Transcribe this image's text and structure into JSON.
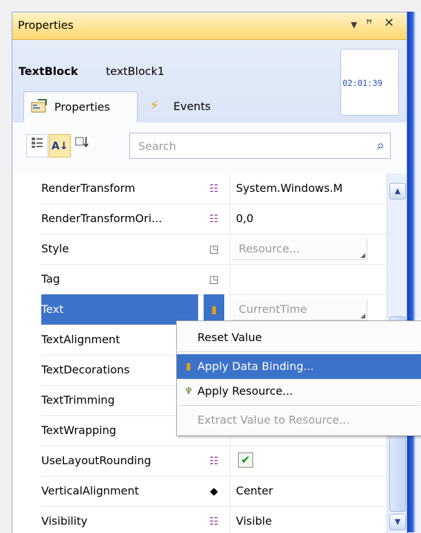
{
  "panel": {
    "title": "Properties",
    "title_icons": [
      "dropdown-arrow-icon",
      "pin-icon",
      "close-icon"
    ]
  },
  "header": {
    "type_name": "TextBlock",
    "instance_name": "textBlock1",
    "preview_text": "02:01:39"
  },
  "tabs": [
    {
      "label": "Properties",
      "icon": "properties-icon",
      "active": true
    },
    {
      "label": "Events",
      "icon": "lightning-icon",
      "active": false
    }
  ],
  "search": {
    "placeholder": "Search",
    "value": ""
  },
  "rows": [
    {
      "name": "RenderTransform",
      "marker": "advanced-properties-icon",
      "value": "System.Windows.M"
    },
    {
      "name": "RenderTransformOri...",
      "marker": "advanced-properties-icon",
      "value": "0,0"
    },
    {
      "name": "Style",
      "marker": "resource-square-icon",
      "value": "Resource..."
    },
    {
      "name": "Tag",
      "marker": "resource-square-icon",
      "value": ""
    },
    {
      "name": "Text",
      "marker": "data-binding-icon",
      "value": "CurrentTime",
      "selected": true
    },
    {
      "name": "TextAlignment",
      "marker": "",
      "value": ""
    },
    {
      "name": "TextDecorations",
      "marker": "",
      "value": ""
    },
    {
      "name": "TextTrimming",
      "marker": "",
      "value": ""
    },
    {
      "name": "TextWrapping",
      "marker": "",
      "value": ""
    },
    {
      "name": "UseLayoutRounding",
      "marker": "advanced-properties-icon",
      "value": "",
      "checked": true
    },
    {
      "name": "VerticalAlignment",
      "marker": "diamond-icon",
      "value": "Center"
    },
    {
      "name": "Visibility",
      "marker": "advanced-properties-icon",
      "value": "Visible"
    }
  ],
  "context_menu": {
    "items": [
      {
        "label": "Reset Value",
        "icon": "",
        "state": "normal"
      },
      {
        "label": "Apply Data Binding...",
        "icon": "data-binding-icon",
        "state": "highlighted"
      },
      {
        "label": "Apply Resource...",
        "icon": "resource-brush-icon",
        "state": "normal"
      },
      {
        "label": "Extract Value to Resource...",
        "icon": "",
        "state": "disabled"
      }
    ]
  },
  "colors": {
    "selection": "#3c72c9",
    "title_bar": "#ffd86e",
    "binding_marker": "#e3a21a"
  }
}
